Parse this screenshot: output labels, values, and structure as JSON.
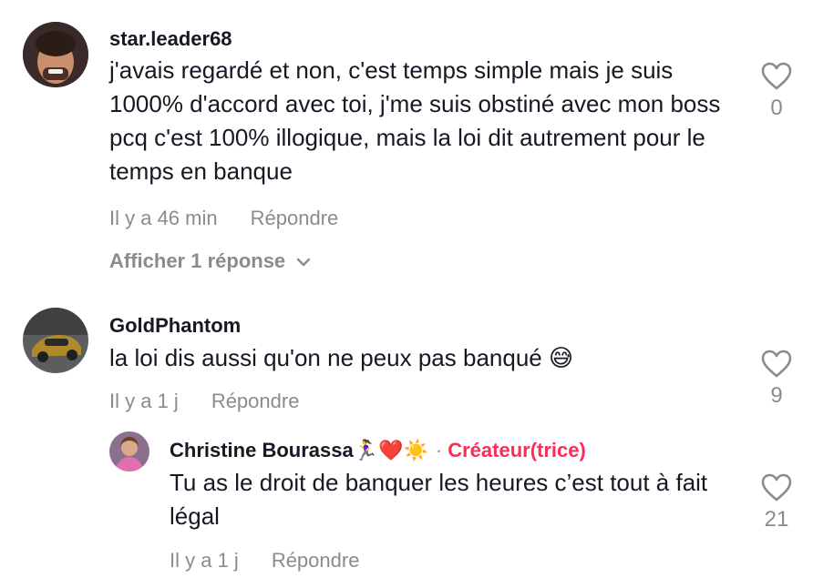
{
  "comments": [
    {
      "username": "star.leader68",
      "text": "j'avais regardé et non, c'est temps simple mais je suis 1000% d'accord avec toi, j'me suis obstiné avec mon boss pcq c'est 100% illogique, mais la loi dit autrement pour le temps en banque",
      "time": "Il y a 46 min",
      "reply_label": "Répondre",
      "likes": "0",
      "show_replies": "Afficher 1 réponse"
    },
    {
      "username": "GoldPhantom",
      "text": "la loi dis aussi qu'on ne peux pas banqué 😅",
      "time": "Il y a 1 j",
      "reply_label": "Répondre",
      "likes": "9",
      "reply": {
        "username": "Christine Bourassa🏃‍♀️❤️☀️",
        "separator": "·",
        "badge": "Créateur(trice)",
        "text": "Tu as le droit de banquer les heures c’est tout à fait légal",
        "time": "Il y a 1 j",
        "reply_label": "Répondre",
        "likes": "21"
      }
    }
  ],
  "colors": {
    "text": "#161823",
    "muted": "#8a8b91",
    "creator": "#fe2c55"
  },
  "icons": {
    "like": "heart-outline-icon",
    "expand": "chevron-down-icon"
  }
}
